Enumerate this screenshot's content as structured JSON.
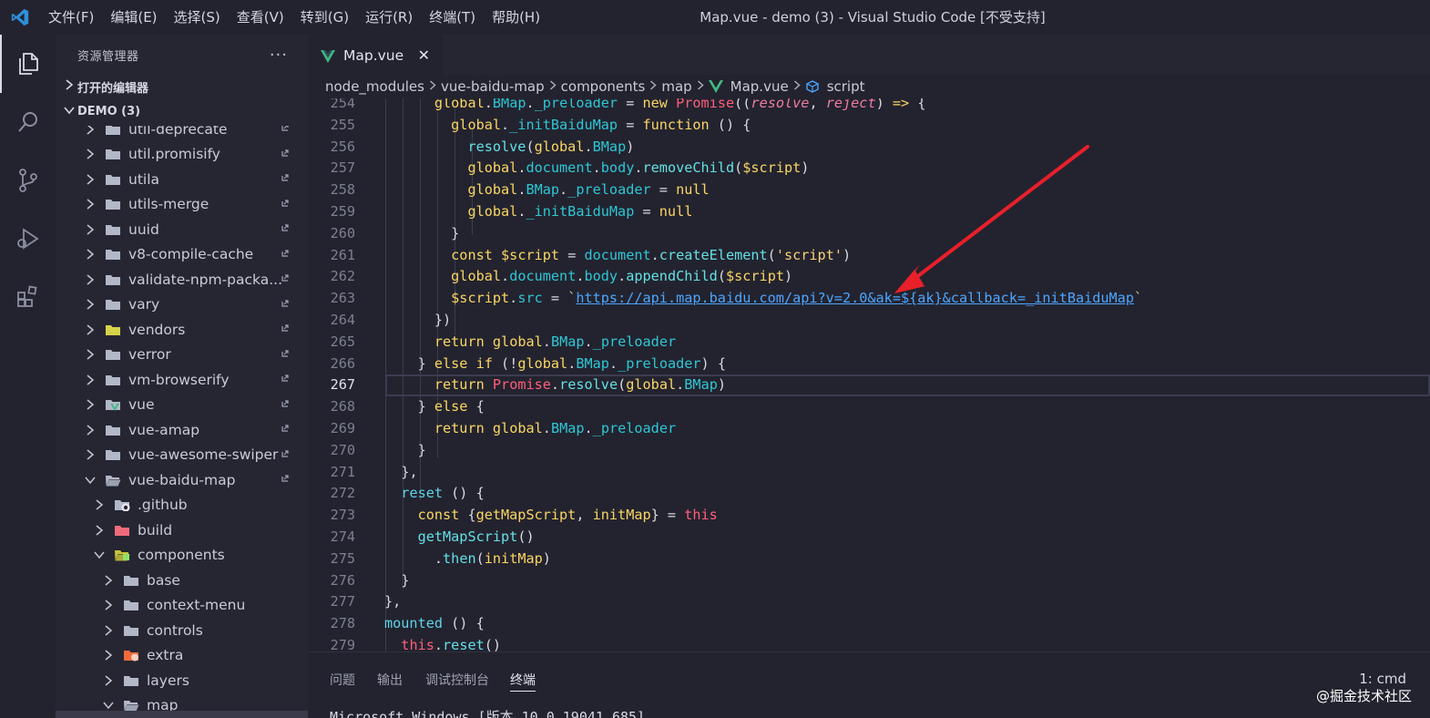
{
  "titlebar": {
    "menu": [
      "文件(F)",
      "编辑(E)",
      "选择(S)",
      "查看(V)",
      "转到(G)",
      "运行(R)",
      "终端(T)",
      "帮助(H)"
    ],
    "window_title": "Map.vue - demo (3) - Visual Studio Code [不受支持]"
  },
  "sidebar": {
    "title": "资源管理器",
    "more": "···",
    "open_editors": "打开的编辑器",
    "root": "DEMO (3)",
    "items": [
      {
        "name": "util-deprecate",
        "kind": "folder",
        "open": false
      },
      {
        "name": "util.promisify",
        "kind": "folder",
        "open": false
      },
      {
        "name": "utila",
        "kind": "folder",
        "open": false
      },
      {
        "name": "utils-merge",
        "kind": "folder",
        "open": false
      },
      {
        "name": "uuid",
        "kind": "folder",
        "open": false
      },
      {
        "name": "v8-compile-cache",
        "kind": "folder",
        "open": false
      },
      {
        "name": "validate-npm-packa...",
        "kind": "folder",
        "open": false
      },
      {
        "name": "vary",
        "kind": "folder",
        "open": false
      },
      {
        "name": "vendors",
        "kind": "folder-yellow",
        "open": false
      },
      {
        "name": "verror",
        "kind": "folder",
        "open": false
      },
      {
        "name": "vm-browserify",
        "kind": "folder",
        "open": false
      },
      {
        "name": "vue",
        "kind": "folder-vue",
        "open": false
      },
      {
        "name": "vue-amap",
        "kind": "folder",
        "open": false
      },
      {
        "name": "vue-awesome-swiper",
        "kind": "folder",
        "open": false
      },
      {
        "name": "vue-baidu-map",
        "kind": "folder",
        "open": true
      },
      {
        "name": ".github",
        "kind": "folder-github",
        "open": false
      },
      {
        "name": "build",
        "kind": "folder-red",
        "open": false
      },
      {
        "name": "components",
        "kind": "folder-components",
        "open": true
      },
      {
        "name": "base",
        "kind": "folder",
        "open": false
      },
      {
        "name": "context-menu",
        "kind": "folder",
        "open": false
      },
      {
        "name": "controls",
        "kind": "folder",
        "open": false
      },
      {
        "name": "extra",
        "kind": "folder-orange",
        "open": false
      },
      {
        "name": "layers",
        "kind": "folder",
        "open": false
      },
      {
        "name": "map",
        "kind": "folder",
        "open": true
      }
    ],
    "colors": {
      "folder": "#b3b8c8",
      "vendors": "#d6d24a",
      "vue": "#41b883",
      "build": "#f06a7b",
      "components": "#c8c23a",
      "extra": "#f06b3c"
    }
  },
  "editor": {
    "tab": {
      "name": "Map.vue",
      "close": "✕"
    },
    "breadcrumb": [
      "node_modules",
      "vue-baidu-map",
      "components",
      "map",
      "Map.vue",
      "script"
    ],
    "lines": [
      {
        "n": "254",
        "tokens": [
          [
            "      ",
            ""
          ],
          [
            "global",
            "t-kw"
          ],
          [
            ".",
            "t-plain"
          ],
          [
            "BMap",
            "t-prop"
          ],
          [
            ".",
            "t-plain"
          ],
          [
            "_preloader",
            "t-prop"
          ],
          [
            " = ",
            "t-plain"
          ],
          [
            "new",
            "t-kw"
          ],
          [
            " ",
            "t-plain"
          ],
          [
            "Promise",
            "t-pink"
          ],
          [
            "((",
            "t-plain"
          ],
          [
            "resolve",
            "t-par"
          ],
          [
            ", ",
            "t-plain"
          ],
          [
            "reject",
            "t-par"
          ],
          [
            ") ",
            "t-plain"
          ],
          [
            "=>",
            "t-kw"
          ],
          [
            " {",
            "t-plain"
          ]
        ]
      },
      {
        "n": "255",
        "tokens": [
          [
            "        ",
            ""
          ],
          [
            "global",
            "t-kw"
          ],
          [
            ".",
            "t-plain"
          ],
          [
            "_initBaiduMap",
            "t-prop"
          ],
          [
            " = ",
            "t-plain"
          ],
          [
            "function",
            "t-kw"
          ],
          [
            " () {",
            "t-plain"
          ]
        ]
      },
      {
        "n": "256",
        "tokens": [
          [
            "          ",
            ""
          ],
          [
            "resolve",
            "t-fn"
          ],
          [
            "(",
            "t-plain"
          ],
          [
            "global",
            "t-kw"
          ],
          [
            ".",
            "t-plain"
          ],
          [
            "BMap",
            "t-prop"
          ],
          [
            ")",
            "t-plain"
          ]
        ]
      },
      {
        "n": "257",
        "tokens": [
          [
            "          ",
            ""
          ],
          [
            "global",
            "t-kw"
          ],
          [
            ".",
            "t-plain"
          ],
          [
            "document",
            "t-prop"
          ],
          [
            ".",
            "t-plain"
          ],
          [
            "body",
            "t-prop"
          ],
          [
            ".",
            "t-plain"
          ],
          [
            "removeChild",
            "t-fn"
          ],
          [
            "(",
            "t-plain"
          ],
          [
            "$script",
            "t-kw"
          ],
          [
            ")",
            "t-plain"
          ]
        ]
      },
      {
        "n": "258",
        "tokens": [
          [
            "          ",
            ""
          ],
          [
            "global",
            "t-kw"
          ],
          [
            ".",
            "t-plain"
          ],
          [
            "BMap",
            "t-prop"
          ],
          [
            ".",
            "t-plain"
          ],
          [
            "_preloader",
            "t-prop"
          ],
          [
            " = ",
            "t-plain"
          ],
          [
            "null",
            "t-kw"
          ]
        ]
      },
      {
        "n": "259",
        "tokens": [
          [
            "          ",
            ""
          ],
          [
            "global",
            "t-kw"
          ],
          [
            ".",
            "t-plain"
          ],
          [
            "_initBaiduMap",
            "t-prop"
          ],
          [
            " = ",
            "t-plain"
          ],
          [
            "null",
            "t-kw"
          ]
        ]
      },
      {
        "n": "260",
        "tokens": [
          [
            "        ",
            ""
          ],
          [
            "}",
            "t-plain"
          ]
        ]
      },
      {
        "n": "261",
        "tokens": [
          [
            "        ",
            ""
          ],
          [
            "const",
            "t-kw"
          ],
          [
            " ",
            "t-plain"
          ],
          [
            "$script",
            "t-kw"
          ],
          [
            " = ",
            "t-plain"
          ],
          [
            "document",
            "t-prop"
          ],
          [
            ".",
            "t-plain"
          ],
          [
            "createElement",
            "t-fn"
          ],
          [
            "(",
            "t-plain"
          ],
          [
            "'script'",
            "t-str"
          ],
          [
            ")",
            "t-plain"
          ]
        ]
      },
      {
        "n": "262",
        "tokens": [
          [
            "        ",
            ""
          ],
          [
            "global",
            "t-kw"
          ],
          [
            ".",
            "t-plain"
          ],
          [
            "document",
            "t-prop"
          ],
          [
            ".",
            "t-plain"
          ],
          [
            "body",
            "t-prop"
          ],
          [
            ".",
            "t-plain"
          ],
          [
            "appendChild",
            "t-fn"
          ],
          [
            "(",
            "t-plain"
          ],
          [
            "$script",
            "t-kw"
          ],
          [
            ")",
            "t-plain"
          ]
        ]
      },
      {
        "n": "263",
        "tokens": [
          [
            "        ",
            ""
          ],
          [
            "$script",
            "t-kw"
          ],
          [
            ".",
            "t-plain"
          ],
          [
            "src",
            "t-prop"
          ],
          [
            " = ",
            "t-plain"
          ],
          [
            "`",
            "t-tpl"
          ],
          [
            "https://api.map.baidu.com/api?v=2.0&ak=${ak}&callback=_initBaiduMap",
            "t-url"
          ],
          [
            "`",
            "t-tpl"
          ]
        ]
      },
      {
        "n": "264",
        "tokens": [
          [
            "      ",
            ""
          ],
          [
            "})",
            "t-plain"
          ]
        ]
      },
      {
        "n": "265",
        "tokens": [
          [
            "      ",
            ""
          ],
          [
            "return",
            "t-kw"
          ],
          [
            " ",
            "t-plain"
          ],
          [
            "global",
            "t-kw"
          ],
          [
            ".",
            "t-plain"
          ],
          [
            "BMap",
            "t-prop"
          ],
          [
            ".",
            "t-plain"
          ],
          [
            "_preloader",
            "t-prop"
          ]
        ]
      },
      {
        "n": "266",
        "tokens": [
          [
            "    ",
            ""
          ],
          [
            "} ",
            "t-plain"
          ],
          [
            "else",
            "t-kw"
          ],
          [
            " ",
            "t-plain"
          ],
          [
            "if",
            "t-kw"
          ],
          [
            " (!",
            "t-plain"
          ],
          [
            "global",
            "t-kw"
          ],
          [
            ".",
            "t-plain"
          ],
          [
            "BMap",
            "t-prop"
          ],
          [
            ".",
            "t-plain"
          ],
          [
            "_preloader",
            "t-prop"
          ],
          [
            ") {",
            "t-plain"
          ]
        ]
      },
      {
        "n": "267",
        "tokens": [
          [
            "      ",
            ""
          ],
          [
            "return",
            "t-kw"
          ],
          [
            " ",
            "t-plain"
          ],
          [
            "Promise",
            "t-pink"
          ],
          [
            ".",
            "t-plain"
          ],
          [
            "resolve",
            "t-fn"
          ],
          [
            "(",
            "t-plain"
          ],
          [
            "global",
            "t-kw"
          ],
          [
            ".",
            "t-plain"
          ],
          [
            "BMap",
            "t-prop"
          ],
          [
            ")",
            "t-plain"
          ]
        ]
      },
      {
        "n": "268",
        "tokens": [
          [
            "    ",
            ""
          ],
          [
            "} ",
            "t-plain"
          ],
          [
            "else",
            "t-kw"
          ],
          [
            " {",
            "t-plain"
          ]
        ]
      },
      {
        "n": "269",
        "tokens": [
          [
            "      ",
            ""
          ],
          [
            "return",
            "t-kw"
          ],
          [
            " ",
            "t-plain"
          ],
          [
            "global",
            "t-kw"
          ],
          [
            ".",
            "t-plain"
          ],
          [
            "BMap",
            "t-prop"
          ],
          [
            ".",
            "t-plain"
          ],
          [
            "_preloader",
            "t-prop"
          ]
        ]
      },
      {
        "n": "270",
        "tokens": [
          [
            "    ",
            ""
          ],
          [
            "}",
            "t-plain"
          ]
        ]
      },
      {
        "n": "271",
        "tokens": [
          [
            "  ",
            ""
          ],
          [
            "},",
            "t-plain"
          ]
        ]
      },
      {
        "n": "272",
        "tokens": [
          [
            "  ",
            ""
          ],
          [
            "reset",
            "t-def"
          ],
          [
            " () {",
            "t-plain"
          ]
        ]
      },
      {
        "n": "273",
        "tokens": [
          [
            "    ",
            ""
          ],
          [
            "const",
            "t-kw"
          ],
          [
            " {",
            "t-plain"
          ],
          [
            "getMapScript",
            "t-kw"
          ],
          [
            ", ",
            "t-plain"
          ],
          [
            "initMap",
            "t-kw"
          ],
          [
            "} = ",
            "t-plain"
          ],
          [
            "this",
            "t-pink"
          ]
        ]
      },
      {
        "n": "274",
        "tokens": [
          [
            "    ",
            ""
          ],
          [
            "getMapScript",
            "t-fn"
          ],
          [
            "()",
            "t-plain"
          ]
        ]
      },
      {
        "n": "275",
        "tokens": [
          [
            "      ",
            ""
          ],
          [
            ".",
            "t-plain"
          ],
          [
            "then",
            "t-fn"
          ],
          [
            "(",
            "t-plain"
          ],
          [
            "initMap",
            "t-kw"
          ],
          [
            ")",
            "t-plain"
          ]
        ]
      },
      {
        "n": "276",
        "tokens": [
          [
            "  ",
            ""
          ],
          [
            "}",
            "t-plain"
          ]
        ]
      },
      {
        "n": "277",
        "tokens": [
          [
            "",
            ""
          ],
          [
            "},",
            "t-plain"
          ]
        ]
      },
      {
        "n": "278",
        "tokens": [
          [
            "",
            ""
          ],
          [
            "mounted",
            "t-def"
          ],
          [
            " () {",
            "t-plain"
          ]
        ]
      },
      {
        "n": "279",
        "tokens": [
          [
            "  ",
            ""
          ],
          [
            "this",
            "t-pink"
          ],
          [
            ".",
            "t-plain"
          ],
          [
            "reset",
            "t-fn"
          ],
          [
            "()",
            "t-plain"
          ]
        ]
      }
    ],
    "current_line": "267"
  },
  "panel": {
    "tabs": [
      "问题",
      "输出",
      "调试控制台",
      "终端"
    ],
    "active_tab": "终端",
    "terminal_select": "1: cmd",
    "terminal_text": "Microsoft Windows [版本 10.0.19041.685]"
  },
  "watermark": "@掘金技术社区"
}
